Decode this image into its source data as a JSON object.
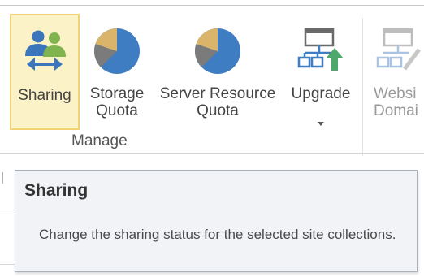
{
  "ribbon": {
    "buttons": [
      {
        "id": "sharing",
        "label": "Sharing",
        "icon": "people-sharing-icon",
        "selected": true
      },
      {
        "id": "storage_quota",
        "label": "Storage\nQuota",
        "icon": "pie-chart-icon"
      },
      {
        "id": "server_resource_quota",
        "label": "Server Resource\nQuota",
        "icon": "pie-chart-icon"
      },
      {
        "id": "upgrade",
        "label": "Upgrade",
        "icon": "upgrade-hierarchy-icon",
        "has_dropdown": true
      },
      {
        "id": "website_domain",
        "label": "Websi\nDomai",
        "icon": "website-hierarchy-icon",
        "disabled": true
      }
    ],
    "groups": [
      {
        "label": "Manage"
      }
    ]
  },
  "tooltip": {
    "title": "Sharing",
    "description": "Change the sharing status for the selected site collections."
  },
  "colors": {
    "selected_bg": "#fcf2c8",
    "selected_border": "#f2d373",
    "pie_blue": "#3f7dc3",
    "pie_tan": "#dab46a",
    "pie_gray": "#7b7b7b",
    "people_blue": "#3b75bb",
    "people_green": "#7fb34e",
    "upgrade_green": "#4ea869",
    "tooltip_bg": "#f1f3f6",
    "tooltip_border": "#a9b1bd"
  }
}
